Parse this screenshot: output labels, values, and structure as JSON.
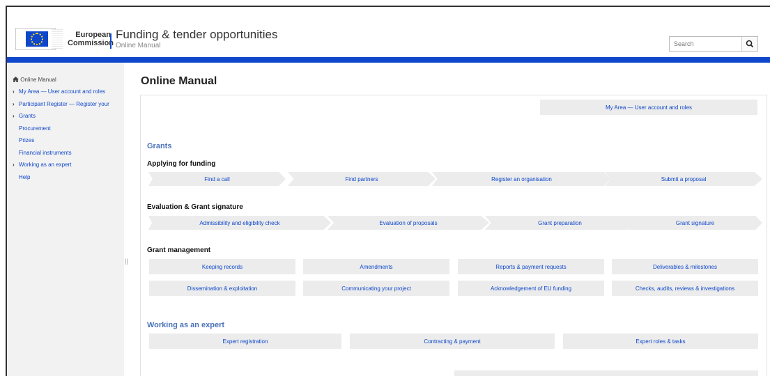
{
  "header": {
    "ec_line1": "European",
    "ec_line2": "Commission",
    "title": "Funding & tender opportunities",
    "subtitle": "Online Manual",
    "search_placeholder": "Search"
  },
  "sidebar": {
    "home_label": "Online Manual",
    "items": [
      {
        "label": "My Area — User account and roles",
        "chevron": true
      },
      {
        "label": "Participant Register — Register your",
        "chevron": true
      },
      {
        "label": "Grants",
        "chevron": true
      },
      {
        "label": "Procurement",
        "chevron": false
      },
      {
        "label": "Prizes",
        "chevron": false
      },
      {
        "label": "Financial instruments",
        "chevron": false
      },
      {
        "label": "Working as an expert",
        "chevron": true
      },
      {
        "label": "Help",
        "chevron": false
      }
    ],
    "collapse_handle": "||"
  },
  "main": {
    "title": "Online Manual",
    "my_area_button": "My Area — User account and roles",
    "grants_heading": "Grants",
    "applying_heading": "Applying for funding",
    "applying_steps": [
      "Find a call",
      "Find partners",
      "Register an organisation",
      "Submit a proposal"
    ],
    "evaluation_heading": "Evaluation & Grant signature",
    "evaluation_steps": [
      "Admissibility and eligibility check",
      "Evaluation of proposals",
      "Grant preparation",
      "Grant signature"
    ],
    "management_heading": "Grant management",
    "management_row1": [
      "Keeping records",
      "Amendments",
      "Reports & payment requests",
      "Deliverables & milestones"
    ],
    "management_row2": [
      "Dissemination & exploitation",
      "Communicating your project",
      "Acknowledgement of EU funding",
      "Checks, audits, reviews & investigations"
    ],
    "expert_heading": "Working as an expert",
    "expert_buttons": [
      "Expert registration",
      "Contracting & payment",
      "Expert roles & tasks"
    ]
  },
  "colors": {
    "brand_blue": "#0e47cb",
    "section_blue": "#4a73b8",
    "button_bg": "#ececec",
    "sidebar_bg": "#f2f2f2"
  }
}
